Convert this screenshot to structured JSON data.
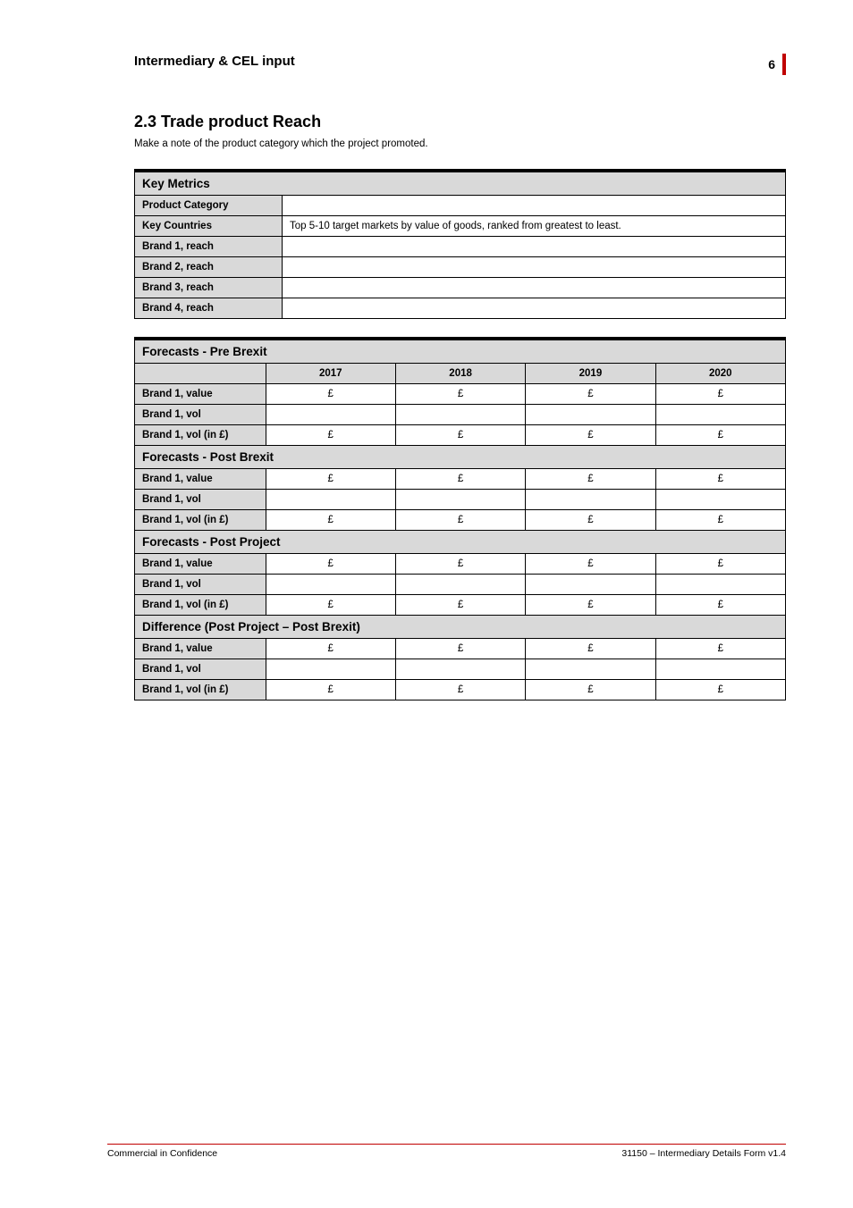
{
  "header": {
    "title": "Intermediary & CEL input",
    "page_number": "6"
  },
  "section": {
    "title": "2.3 Trade product Reach",
    "subtitle": "Make a note of the product category which the project promoted."
  },
  "table1": {
    "header": "Key Metrics",
    "rows": [
      {
        "label": "Product Category",
        "value": ""
      },
      {
        "label": "Key Countries",
        "value": "Top 5-10 target markets by value of goods, ranked from greatest to least."
      },
      {
        "label": "Brand 1, reach",
        "value": ""
      },
      {
        "label": "Brand 2, reach",
        "value": ""
      },
      {
        "label": "Brand 3, reach",
        "value": ""
      },
      {
        "label": "Brand 4, reach",
        "value": ""
      }
    ]
  },
  "table2": {
    "header": "Forecasts - Pre Brexit",
    "col_labels": [
      "",
      "2017",
      "2018",
      "2019",
      "2020"
    ],
    "sections": [
      {
        "rows": [
          {
            "label": "Brand 1, value",
            "cells": [
              "£",
              "£",
              "£",
              "£"
            ]
          },
          {
            "label": "Brand 1, vol",
            "cells": [
              "",
              "",
              "",
              ""
            ]
          },
          {
            "label": "Brand 1, vol (in £)",
            "cells": [
              "£",
              "£",
              "£",
              "£"
            ]
          }
        ]
      },
      {
        "sub_header": "Forecasts - Post Brexit",
        "rows": [
          {
            "label": "Brand 1, value",
            "cells": [
              "£",
              "£",
              "£",
              "£"
            ]
          },
          {
            "label": "Brand 1, vol",
            "cells": [
              "",
              "",
              "",
              ""
            ]
          },
          {
            "label": "Brand 1, vol (in £)",
            "cells": [
              "£",
              "£",
              "£",
              "£"
            ]
          }
        ]
      },
      {
        "sub_header": "Forecasts - Post Project",
        "rows": [
          {
            "label": "Brand 1, value",
            "cells": [
              "£",
              "£",
              "£",
              "£"
            ]
          },
          {
            "label": "Brand 1, vol",
            "cells": [
              "",
              "",
              "",
              ""
            ]
          },
          {
            "label": "Brand 1, vol (in £)",
            "cells": [
              "£",
              "£",
              "£",
              "£"
            ]
          }
        ]
      },
      {
        "sub_header": "Difference (Post Project – Post Brexit)",
        "rows": [
          {
            "label": "Brand 1, value",
            "cells": [
              "£",
              "£",
              "£",
              "£"
            ]
          },
          {
            "label": "Brand 1, vol",
            "cells": [
              "",
              "",
              "",
              ""
            ]
          },
          {
            "label": "Brand 1, vol (in £)",
            "cells": [
              "£",
              "£",
              "£",
              "£"
            ]
          }
        ]
      }
    ]
  },
  "footer": {
    "left": "Commercial in Confidence",
    "right": "31150 – Intermediary Details Form v1.4"
  }
}
